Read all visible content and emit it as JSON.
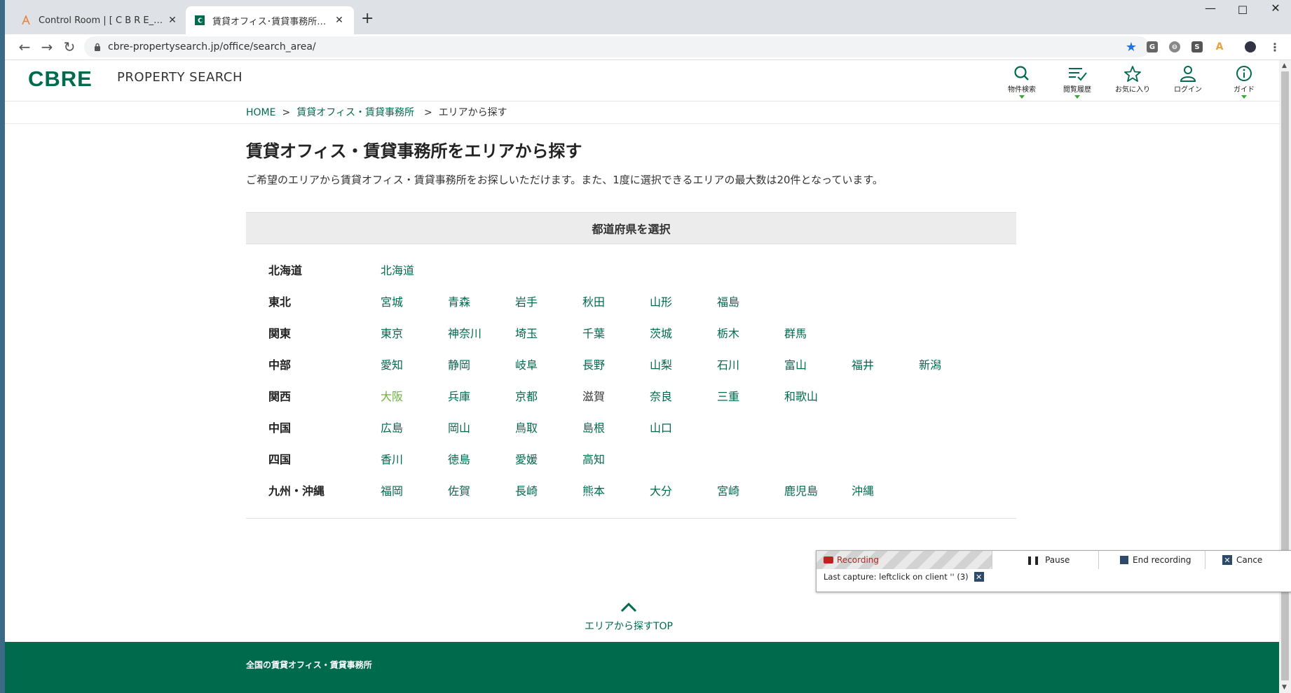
{
  "browser": {
    "tabs": [
      {
        "title": "Control Room | [ C B R E_Ctrl] Ta",
        "active": false
      },
      {
        "title": "賃貸オフィス･賃貸事務所をエリアから",
        "active": true
      }
    ],
    "new_tab": "+",
    "url": "cbre-propertysearch.jp/office/search_area/",
    "extensions": [
      "G",
      "S"
    ]
  },
  "site": {
    "logo": "CBRE",
    "name": "PROPERTY SEARCH",
    "nav": [
      {
        "label": "物件検索",
        "icon": "search-icon"
      },
      {
        "label": "閲覧履歴",
        "icon": "history-icon"
      },
      {
        "label": "お気に入り",
        "icon": "star-icon"
      },
      {
        "label": "ログイン",
        "icon": "user-icon"
      },
      {
        "label": "ガイド",
        "icon": "info-icon"
      }
    ]
  },
  "breadcrumb": {
    "home": "HOME",
    "sep1": ">",
    "category": "賃貸オフィス・賃貸事務所",
    "sep2": ">",
    "current": "エリアから探す"
  },
  "page": {
    "title": "賃貸オフィス・賃貸事務所をエリアから探す",
    "lead": "ご希望のエリアから賃貸オフィス・賃貸事務所をお探しいただけます。また、1度に選択できるエリアの最大数は20件となっています。",
    "panel_title": "都道府県を選択"
  },
  "regions": [
    {
      "name": "北海道",
      "prefs": [
        "北海道"
      ]
    },
    {
      "name": "東北",
      "prefs": [
        "宮城",
        "青森",
        "岩手",
        "秋田",
        "山形",
        "福島"
      ]
    },
    {
      "name": "関東",
      "prefs": [
        "東京",
        "神奈川",
        "埼玉",
        "千葉",
        "茨城",
        "栃木",
        "群馬"
      ]
    },
    {
      "name": "中部",
      "prefs": [
        "愛知",
        "静岡",
        "岐阜",
        "長野",
        "山梨",
        "石川",
        "富山",
        "福井",
        "新潟"
      ]
    },
    {
      "name": "関西",
      "prefs": [
        "大阪",
        "兵庫",
        "京都",
        "滋賀",
        "奈良",
        "三重",
        "和歌山"
      ]
    },
    {
      "name": "中国",
      "prefs": [
        "広島",
        "岡山",
        "鳥取",
        "島根",
        "山口"
      ]
    },
    {
      "name": "四国",
      "prefs": [
        "香川",
        "徳島",
        "愛媛",
        "高知"
      ]
    },
    {
      "name": "九州・沖縄",
      "prefs": [
        "福岡",
        "佐賀",
        "長崎",
        "熊本",
        "大分",
        "宮崎",
        "鹿児島",
        "沖縄"
      ]
    }
  ],
  "pref_states": {
    "active": [
      "大阪"
    ],
    "disabled": [
      "滋賀"
    ]
  },
  "colors": {
    "brand": "#006a4d",
    "link": "#006a4d",
    "active_link": "#6db33f"
  },
  "to_top": "エリアから探すTOP",
  "footer": {
    "title": "全国の賃貸オフィス・賃貸事務所"
  },
  "recorder": {
    "status": "Recording",
    "pause": "Pause",
    "end": "End recording",
    "cancel": "Cance",
    "last_capture": "Last capture:   leftclick on client ''   (3)"
  }
}
